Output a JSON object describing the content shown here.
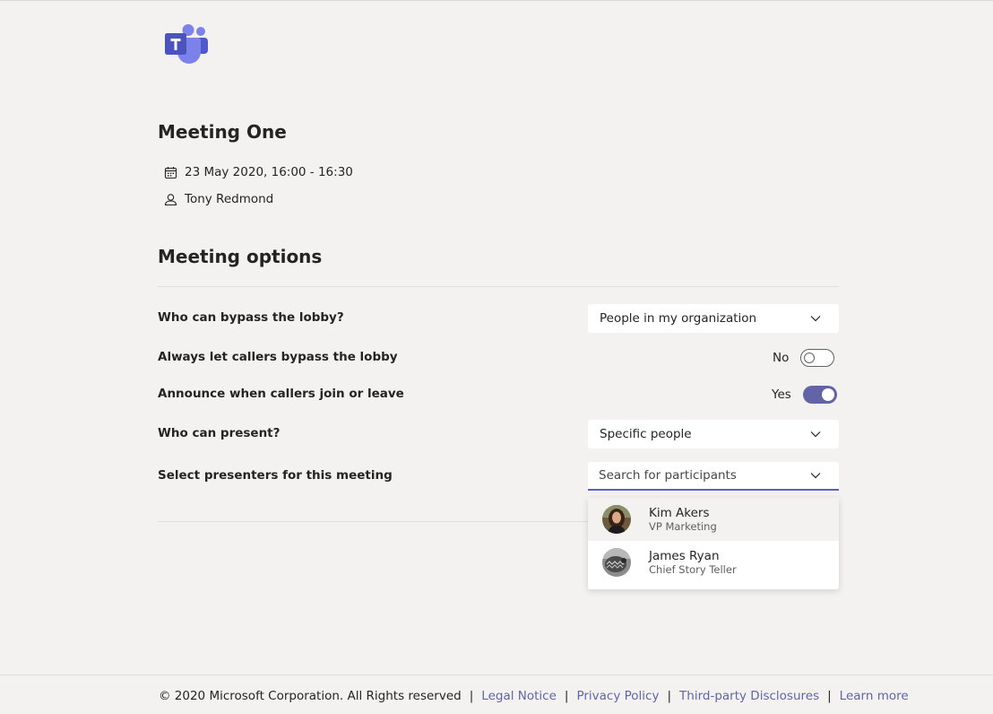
{
  "meeting": {
    "title": "Meeting One",
    "datetime": "23 May 2020, 16:00 - 16:30",
    "organizer": "Tony Redmond"
  },
  "options": {
    "section_title": "Meeting options",
    "bypass_lobby": {
      "label": "Who can bypass the lobby?",
      "value": "People in my organization"
    },
    "callers_bypass": {
      "label": "Always let callers bypass the lobby",
      "state": "No"
    },
    "announce_callers": {
      "label": "Announce when callers join or leave",
      "state": "Yes"
    },
    "who_present": {
      "label": "Who can present?",
      "value": "Specific people"
    },
    "select_presenters": {
      "label": "Select presenters for this meeting",
      "placeholder": "Search for participants"
    }
  },
  "participants": [
    {
      "name": "Kim Akers",
      "title": "VP Marketing"
    },
    {
      "name": "James Ryan",
      "title": "Chief Story Teller"
    }
  ],
  "footer": {
    "copyright": "© 2020 Microsoft Corporation. All Rights reserved",
    "separator": "|",
    "legal": "Legal Notice",
    "privacy": "Privacy Policy",
    "third_party": "Third-party Disclosures",
    "learn_more": "Learn more"
  },
  "colors": {
    "brand": "#6264a7",
    "background": "#f3f2f1",
    "accent_underline": "#5b5fc7"
  },
  "icons": {
    "logo": "teams-logo-icon",
    "calendar": "calendar-icon",
    "person": "person-icon",
    "chevron": "chevron-down-icon"
  }
}
